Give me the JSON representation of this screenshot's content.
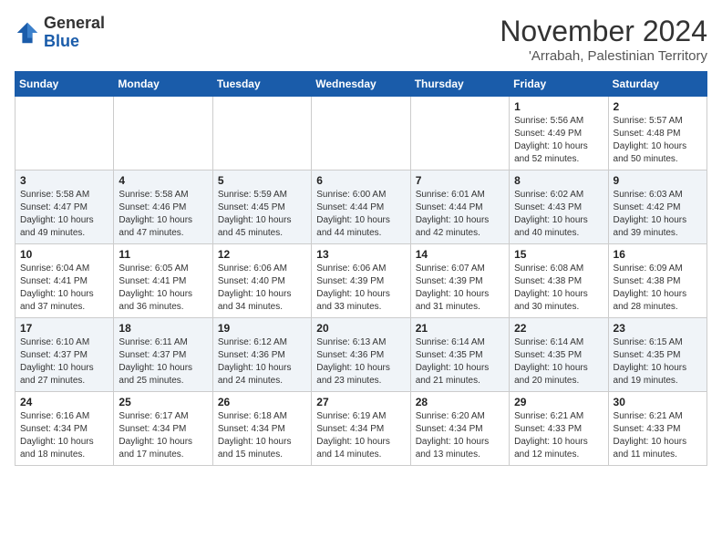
{
  "logo": {
    "text_general": "General",
    "text_blue": "Blue"
  },
  "header": {
    "month_year": "November 2024",
    "location": "'Arrabah, Palestinian Territory"
  },
  "days_of_week": [
    "Sunday",
    "Monday",
    "Tuesday",
    "Wednesday",
    "Thursday",
    "Friday",
    "Saturday"
  ],
  "weeks": [
    [
      {
        "day": "",
        "info": ""
      },
      {
        "day": "",
        "info": ""
      },
      {
        "day": "",
        "info": ""
      },
      {
        "day": "",
        "info": ""
      },
      {
        "day": "",
        "info": ""
      },
      {
        "day": "1",
        "info": "Sunrise: 5:56 AM\nSunset: 4:49 PM\nDaylight: 10 hours\nand 52 minutes."
      },
      {
        "day": "2",
        "info": "Sunrise: 5:57 AM\nSunset: 4:48 PM\nDaylight: 10 hours\nand 50 minutes."
      }
    ],
    [
      {
        "day": "3",
        "info": "Sunrise: 5:58 AM\nSunset: 4:47 PM\nDaylight: 10 hours\nand 49 minutes."
      },
      {
        "day": "4",
        "info": "Sunrise: 5:58 AM\nSunset: 4:46 PM\nDaylight: 10 hours\nand 47 minutes."
      },
      {
        "day": "5",
        "info": "Sunrise: 5:59 AM\nSunset: 4:45 PM\nDaylight: 10 hours\nand 45 minutes."
      },
      {
        "day": "6",
        "info": "Sunrise: 6:00 AM\nSunset: 4:44 PM\nDaylight: 10 hours\nand 44 minutes."
      },
      {
        "day": "7",
        "info": "Sunrise: 6:01 AM\nSunset: 4:44 PM\nDaylight: 10 hours\nand 42 minutes."
      },
      {
        "day": "8",
        "info": "Sunrise: 6:02 AM\nSunset: 4:43 PM\nDaylight: 10 hours\nand 40 minutes."
      },
      {
        "day": "9",
        "info": "Sunrise: 6:03 AM\nSunset: 4:42 PM\nDaylight: 10 hours\nand 39 minutes."
      }
    ],
    [
      {
        "day": "10",
        "info": "Sunrise: 6:04 AM\nSunset: 4:41 PM\nDaylight: 10 hours\nand 37 minutes."
      },
      {
        "day": "11",
        "info": "Sunrise: 6:05 AM\nSunset: 4:41 PM\nDaylight: 10 hours\nand 36 minutes."
      },
      {
        "day": "12",
        "info": "Sunrise: 6:06 AM\nSunset: 4:40 PM\nDaylight: 10 hours\nand 34 minutes."
      },
      {
        "day": "13",
        "info": "Sunrise: 6:06 AM\nSunset: 4:39 PM\nDaylight: 10 hours\nand 33 minutes."
      },
      {
        "day": "14",
        "info": "Sunrise: 6:07 AM\nSunset: 4:39 PM\nDaylight: 10 hours\nand 31 minutes."
      },
      {
        "day": "15",
        "info": "Sunrise: 6:08 AM\nSunset: 4:38 PM\nDaylight: 10 hours\nand 30 minutes."
      },
      {
        "day": "16",
        "info": "Sunrise: 6:09 AM\nSunset: 4:38 PM\nDaylight: 10 hours\nand 28 minutes."
      }
    ],
    [
      {
        "day": "17",
        "info": "Sunrise: 6:10 AM\nSunset: 4:37 PM\nDaylight: 10 hours\nand 27 minutes."
      },
      {
        "day": "18",
        "info": "Sunrise: 6:11 AM\nSunset: 4:37 PM\nDaylight: 10 hours\nand 25 minutes."
      },
      {
        "day": "19",
        "info": "Sunrise: 6:12 AM\nSunset: 4:36 PM\nDaylight: 10 hours\nand 24 minutes."
      },
      {
        "day": "20",
        "info": "Sunrise: 6:13 AM\nSunset: 4:36 PM\nDaylight: 10 hours\nand 23 minutes."
      },
      {
        "day": "21",
        "info": "Sunrise: 6:14 AM\nSunset: 4:35 PM\nDaylight: 10 hours\nand 21 minutes."
      },
      {
        "day": "22",
        "info": "Sunrise: 6:14 AM\nSunset: 4:35 PM\nDaylight: 10 hours\nand 20 minutes."
      },
      {
        "day": "23",
        "info": "Sunrise: 6:15 AM\nSunset: 4:35 PM\nDaylight: 10 hours\nand 19 minutes."
      }
    ],
    [
      {
        "day": "24",
        "info": "Sunrise: 6:16 AM\nSunset: 4:34 PM\nDaylight: 10 hours\nand 18 minutes."
      },
      {
        "day": "25",
        "info": "Sunrise: 6:17 AM\nSunset: 4:34 PM\nDaylight: 10 hours\nand 17 minutes."
      },
      {
        "day": "26",
        "info": "Sunrise: 6:18 AM\nSunset: 4:34 PM\nDaylight: 10 hours\nand 15 minutes."
      },
      {
        "day": "27",
        "info": "Sunrise: 6:19 AM\nSunset: 4:34 PM\nDaylight: 10 hours\nand 14 minutes."
      },
      {
        "day": "28",
        "info": "Sunrise: 6:20 AM\nSunset: 4:34 PM\nDaylight: 10 hours\nand 13 minutes."
      },
      {
        "day": "29",
        "info": "Sunrise: 6:21 AM\nSunset: 4:33 PM\nDaylight: 10 hours\nand 12 minutes."
      },
      {
        "day": "30",
        "info": "Sunrise: 6:21 AM\nSunset: 4:33 PM\nDaylight: 10 hours\nand 11 minutes."
      }
    ]
  ]
}
